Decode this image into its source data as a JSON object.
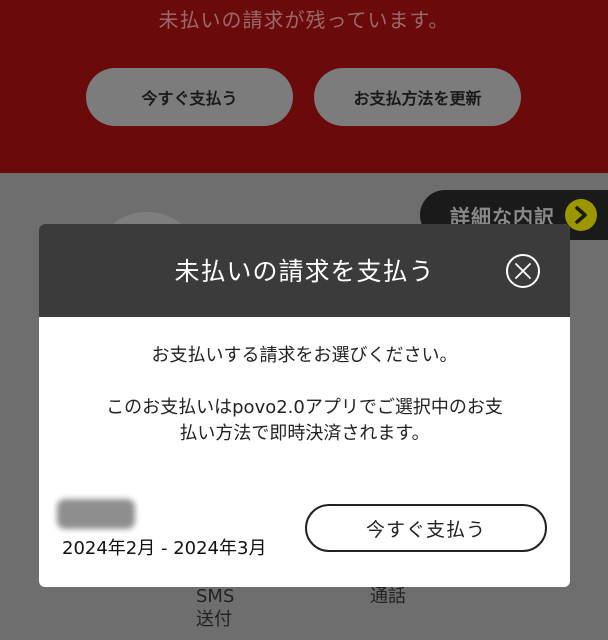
{
  "background": {
    "unpaid_message": "未払いの請求が残っています。",
    "pay_now_label": "今すぐ支払う",
    "update_method_label": "お支払方法を更新",
    "details_label": "詳細な内訳",
    "sms_label_line1": "SMS",
    "sms_label_line2": "送付",
    "call_label": "通話"
  },
  "modal": {
    "title": "未払いの請求を支払う",
    "instruction": "お支払いする請求をお選びください。",
    "note_line1": "このお支払いはpovo2.0アプリでご選択中のお支",
    "note_line2": "払い方法で即時決済されます。",
    "billing_period": "2024年2月 - 2024年3月",
    "pay_now_label": "今すぐ支払う"
  },
  "colors": {
    "header_bg": "#3b3b3b",
    "backdrop_top": "#6a0a0a",
    "accent_arrow": "#9c9700"
  }
}
